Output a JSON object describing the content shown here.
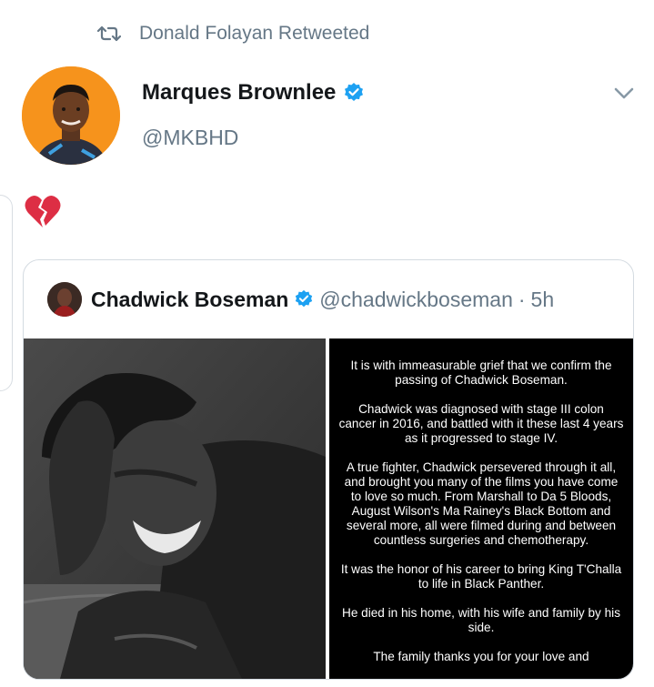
{
  "retweet": {
    "text": "Donald Folayan Retweeted",
    "icon": "retweet-icon"
  },
  "tweet": {
    "author_name": "Marques Brownlee",
    "author_handle": "@MKBHD",
    "verified": true,
    "body_emoji": "broken-heart-icon",
    "menu_icon": "chevron-down-icon"
  },
  "quoted_tweet": {
    "author_name": "Chadwick Boseman",
    "author_handle": "@chadwickboseman",
    "separator": "·",
    "time": "5h",
    "verified": true,
    "statement": [
      "It is with immeasurable grief that we confirm the passing of Chadwick Boseman.",
      "Chadwick was diagnosed with stage III colon cancer in 2016, and battled with it these last 4 years as it progressed to stage IV.",
      "A true fighter, Chadwick persevered through it all, and brought you many of the films you have come to love so much. From Marshall to Da 5 Bloods, August Wilson's Ma Rainey's Black Bottom and several more, all were filmed during and between countless surgeries and chemotherapy.",
      "It was the honor of his career to bring King T'Challa to life in Black Panther.",
      "He died in his home, with his wife and family by his side.",
      "The family thanks you for your love and"
    ]
  },
  "colors": {
    "accent": "#1da1f2",
    "secondary_text": "#657786",
    "heart": "#dd2e44"
  }
}
